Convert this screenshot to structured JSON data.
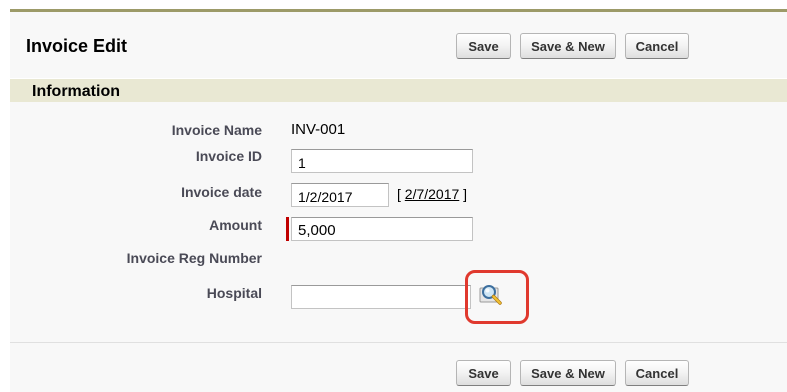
{
  "header": {
    "title": "Invoice Edit",
    "buttons": {
      "save": "Save",
      "save_new": "Save & New",
      "cancel": "Cancel"
    }
  },
  "section": {
    "title": "Information"
  },
  "fields": {
    "invoice_name": {
      "label": "Invoice Name",
      "value": "INV-001"
    },
    "invoice_id": {
      "label": "Invoice ID",
      "value": "1"
    },
    "invoice_date": {
      "label": "Invoice date",
      "value": "1/2/2017",
      "today_prefix": "[ ",
      "today_link": "2/7/2017",
      "today_suffix": " ]"
    },
    "amount": {
      "label": "Amount",
      "value": "5,000",
      "required": true
    },
    "invoice_reg_number": {
      "label": "Invoice Reg Number",
      "value": ""
    },
    "hospital": {
      "label": "Hospital",
      "value": "",
      "lookup_icon": "magnifier-lookup-icon"
    }
  },
  "footer": {
    "buttons": {
      "save": "Save",
      "save_new": "Save & New",
      "cancel": "Cancel"
    }
  },
  "colors": {
    "header_rule": "#9c9a68",
    "section_bar": "#e9e8d3",
    "required": "#c00000",
    "highlight": "#e0392e"
  }
}
